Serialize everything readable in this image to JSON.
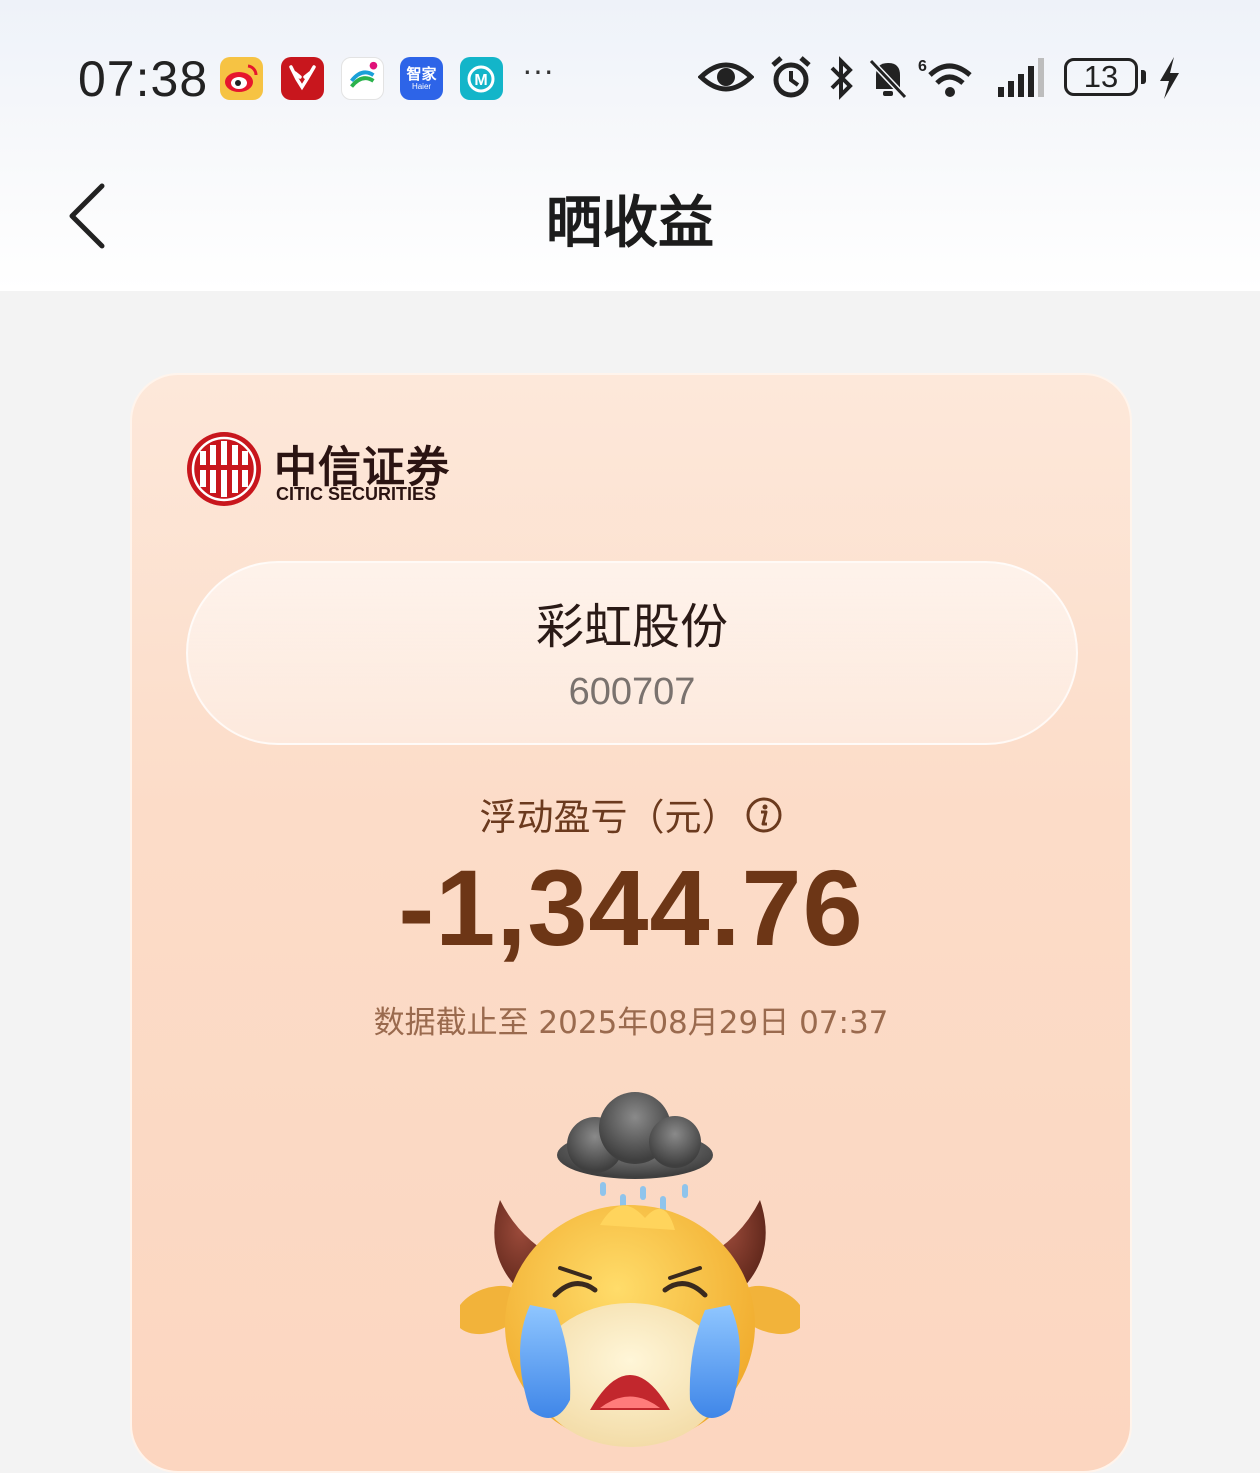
{
  "status_bar": {
    "time": "07:38",
    "notification_apps": [
      "weibo-icon",
      "antlers-app-icon",
      "china-mobile-icon",
      "haier-smart-home-icon",
      "m-app-icon"
    ],
    "haier_label_top": "智家",
    "haier_label_bottom": "Haier",
    "more": "···",
    "battery_level": "13",
    "charging": true
  },
  "nav": {
    "title": "晒收益"
  },
  "card": {
    "broker_cn": "中信证券",
    "broker_en": "CITIC SECURITIES",
    "stock_name": "彩虹股份",
    "stock_code": "600707",
    "pnl_label": "浮动盈亏（元）",
    "pnl_value": "-1,344.76",
    "data_time": "数据截止至 2025年08月29日 07:37"
  },
  "colors": {
    "brand_red": "#c8161d",
    "pnl_text": "#6d3616",
    "card_bg": "#fcdcc8"
  }
}
